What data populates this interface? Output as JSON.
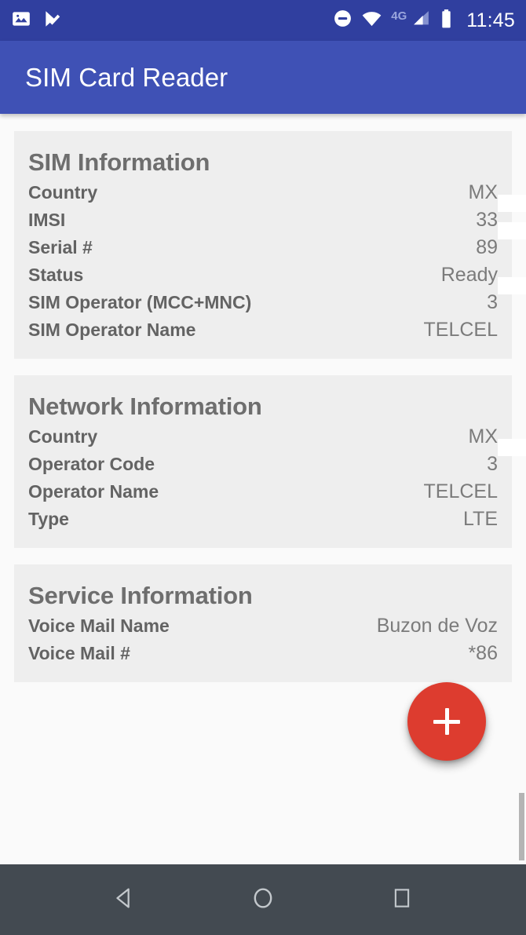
{
  "status_bar": {
    "time": "11:45",
    "network_label": "4G",
    "icons": [
      "image-icon",
      "tasks-check-icon",
      "do-not-disturb-icon",
      "wifi-icon",
      "signal-icon",
      "battery-icon"
    ]
  },
  "app_bar": {
    "title": "SIM Card Reader"
  },
  "cards": [
    {
      "title": "SIM Information",
      "rows": [
        {
          "label": "Country",
          "value": "MX",
          "redacted": false
        },
        {
          "label": "IMSI",
          "value": "33",
          "redacted": true,
          "redact_width": 206
        },
        {
          "label": "Serial #",
          "value": "89",
          "redacted": true,
          "redact_width": 272
        },
        {
          "label": "Status",
          "value": "Ready",
          "redacted": false
        },
        {
          "label": "SIM Operator (MCC+MNC)",
          "value": "3",
          "redacted": true,
          "redact_width": 56
        },
        {
          "label": "SIM Operator Name",
          "value": "TELCEL",
          "redacted": false
        }
      ]
    },
    {
      "title": "Network Information",
      "rows": [
        {
          "label": "Country",
          "value": "MX",
          "redacted": false
        },
        {
          "label": "Operator Code",
          "value": "3",
          "redacted": true,
          "redact_width": 56
        },
        {
          "label": "Operator Name",
          "value": "TELCEL",
          "redacted": false
        },
        {
          "label": "Type",
          "value": "LTE",
          "redacted": false
        }
      ]
    },
    {
      "title": "Service Information",
      "rows": [
        {
          "label": "Voice Mail Name",
          "value": "Buzon de Voz",
          "redacted": false
        },
        {
          "label": "Voice Mail #",
          "value": "*86",
          "redacted": false
        }
      ]
    }
  ],
  "fab": {
    "label": "+",
    "icon": "plus-icon",
    "color": "#dd3c2f"
  },
  "nav_bar": {
    "back": "back-triangle-icon",
    "home": "home-circle-icon",
    "recents": "recents-square-icon"
  },
  "colors": {
    "status_bar": "#303f9f",
    "app_bar": "#3f51b5",
    "card": "#eeeeee",
    "page": "#fafafa",
    "nav_bar": "#434a51",
    "accent": "#dd3c2f"
  }
}
